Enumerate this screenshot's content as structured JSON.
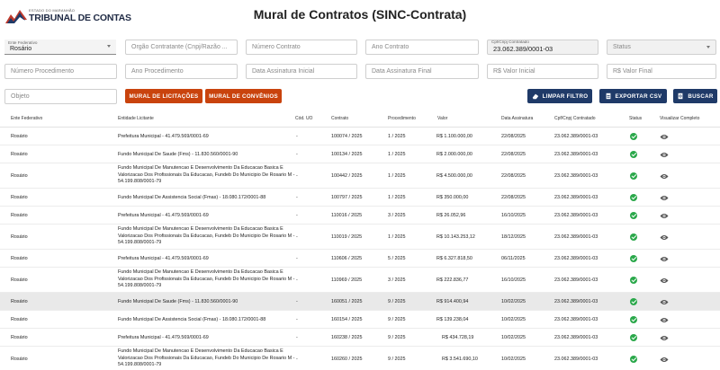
{
  "header": {
    "logo_small": "ESTADO DO MARANHÃO",
    "logo_big": "TRIBUNAL DE CONTAS",
    "title": "Mural de Contratos (SINC-Contrata)"
  },
  "filters": {
    "ente_label": "Ente Federativo",
    "ente_value": "Rosário",
    "orgao_placeholder": "Orgão Contratante (Cnpj/Razão ...",
    "numero_contrato_placeholder": "Número Contrato",
    "ano_contrato_placeholder": "Ano Contrato",
    "cpf_label": "Cpf/Cnpj Contratado",
    "cpf_value": "23.062.389/0001-03",
    "status_placeholder": "Status",
    "numero_proc_placeholder": "Número Procedimento",
    "ano_proc_placeholder": "Ano Procedimento",
    "data_ini_placeholder": "Data Assinatura Inicial",
    "data_fim_placeholder": "Data Assinatura Final",
    "valor_ini_placeholder": "R$ Valor Inicial",
    "valor_fim_placeholder": "R$ Valor Final",
    "objeto_placeholder": "Objeto"
  },
  "buttons": {
    "mural_licitacoes": "MURAL DE LICITAÇÕES",
    "mural_convenios": "MURAL DE CONVÊNIOS",
    "limpar": "LIMPAR FILTRO",
    "exportar": "EXPORTAR CSV",
    "buscar": "BUSCAR"
  },
  "table": {
    "headers": {
      "ente": "Ente Federativo",
      "entidade": "Entidade Licitante",
      "cod_uo": "Cód. UO",
      "contrato": "Contrato",
      "procedimento": "Procedimento",
      "valor": "Valor",
      "data": "Data Assinatura",
      "cpf": "Cpf/Cnpj Contratado",
      "status": "Status",
      "visualizar": "Visualizar Completo"
    },
    "rows": [
      {
        "ente": "Rosário",
        "entidade": "Prefeitura Municipal - 41.479.569/0001-69",
        "cod": "-",
        "contrato": "100074 / 2025",
        "proc": "1 / 2025",
        "valor": "R$ 1.100.000,00",
        "data": "22/08/2025",
        "cpf": "23.062.389/0001-03"
      },
      {
        "ente": "Rosário",
        "entidade": "Fundo Municipal De Saude (Fms) - 11.830.560/0001-90",
        "cod": "-",
        "contrato": "100134 / 2025",
        "proc": "1 / 2025",
        "valor": "R$ 2.000.000,00",
        "data": "22/08/2025",
        "cpf": "23.062.389/0001-03"
      },
      {
        "ente": "Rosário",
        "entidade": "Fundo Municipal De Manutencao E Desenvolvimento Da Educacao Basica E Valorizacao Dos Profissionais Da Educacao, Fundeb Do Municipio De Rosario M - 54.199.808/0001-79",
        "cod": "-",
        "contrato": "100442 / 2025",
        "proc": "1 / 2025",
        "valor": "R$ 4.500.000,00",
        "data": "22/08/2025",
        "cpf": "23.062.389/0001-03"
      },
      {
        "ente": "Rosário",
        "entidade": "Fundo Municipal De Assistencia Social (Fmas) - 18.080.172/0001-88",
        "cod": "-",
        "contrato": "100797 / 2025",
        "proc": "1 / 2025",
        "valor": "R$ 350.000,00",
        "data": "22/08/2025",
        "cpf": "23.062.389/0001-03"
      },
      {
        "ente": "Rosário",
        "entidade": "Prefeitura Municipal - 41.479.569/0001-69",
        "cod": "-",
        "contrato": "110016 / 2025",
        "proc": "3 / 2025",
        "valor": "R$ 26.052,96",
        "data": "16/10/2025",
        "cpf": "23.062.389/0001-03"
      },
      {
        "ente": "Rosário",
        "entidade": "Fundo Municipal De Manutencao E Desenvolvimento Da Educacao Basica E Valorizacao Dos Profissionais Da Educacao, Fundeb Do Municipio De Rosario M - 54.199.808/0001-79",
        "cod": "-",
        "contrato": "110019 / 2025",
        "proc": "1 / 2025",
        "valor": "R$ 10.143.253,12",
        "data": "18/12/2025",
        "cpf": "23.062.389/0001-03"
      },
      {
        "ente": "Rosário",
        "entidade": "Prefeitura Municipal - 41.479.569/0001-69",
        "cod": "-",
        "contrato": "110606 / 2025",
        "proc": "5 / 2025",
        "valor": "R$ 6.327.818,50",
        "data": "06/11/2025",
        "cpf": "23.062.389/0001-03"
      },
      {
        "ente": "Rosário",
        "entidade": "Fundo Municipal De Manutencao E Desenvolvimento Da Educacao Basica E Valorizacao Dos Profissionais Da Educacao, Fundeb Do Municipio De Rosario M - 54.199.808/0001-79",
        "cod": "-",
        "contrato": "110969 / 2025",
        "proc": "3 / 2025",
        "valor": "R$ 222.836,77",
        "data": "16/10/2025",
        "cpf": "23.062.389/0001-03"
      },
      {
        "ente": "Rosário",
        "entidade": "Fundo Municipal De Saude (Fms) - 11.830.560/0001-90",
        "cod": "-",
        "contrato": "160051 / 2025",
        "proc": "9 / 2025",
        "valor": "R$ 914.400,94",
        "data": "10/02/2025",
        "cpf": "23.062.389/0001-03"
      },
      {
        "ente": "Rosário",
        "entidade": "Fundo Municipal De Assistencia Social (Fmas) - 18.080.172/0001-88",
        "cod": "-",
        "contrato": "160154 / 2025",
        "proc": "9 / 2025",
        "valor": "R$ 139.238,04",
        "data": "10/02/2025",
        "cpf": "23.062.389/0001-03"
      },
      {
        "ente": "Rosário",
        "entidade": "Prefeitura Municipal - 41.479.569/0001-69",
        "cod": "-",
        "contrato": "160238 / 2025",
        "proc": "9 / 2025",
        "valor": "R$ 434.728,19",
        "data": "10/02/2025",
        "cpf": "23.062.389/0001-03"
      },
      {
        "ente": "Rosário",
        "entidade": "Fundo Municipal De Manutencao E Desenvolvimento Da Educacao Basica E Valorizacao Dos Profissionais Da Educacao, Fundeb Do Municipio De Rosario M - 54.199.808/0001-79",
        "cod": "-",
        "contrato": "160260 / 2025",
        "proc": "9 / 2025",
        "valor": "R$ 3.541.690,10",
        "data": "10/02/2025",
        "cpf": "23.062.389/0001-03"
      }
    ]
  },
  "colors": {
    "orange": "#c9430d",
    "navy": "#1f3a68",
    "status_ok": "#2aa84a"
  }
}
